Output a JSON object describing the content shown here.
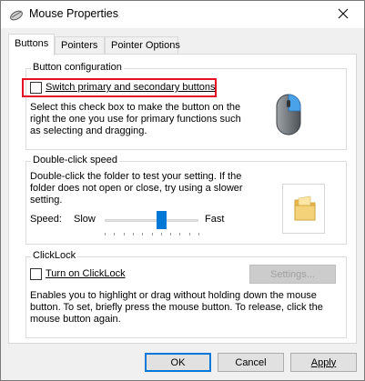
{
  "window": {
    "title": "Mouse Properties",
    "icon": "mouse-icon"
  },
  "tabs": [
    {
      "label": "Buttons",
      "active": true
    },
    {
      "label": "Pointers",
      "active": false
    },
    {
      "label": "Pointer Options",
      "active": false
    }
  ],
  "button_config": {
    "title": "Button configuration",
    "checkbox_label": "Switch primary and secondary buttons",
    "checked": false,
    "description": [
      "Select this check box to make the button on the",
      "right the one you use for primary functions such",
      "as selecting and dragging."
    ]
  },
  "double_click": {
    "title": "Double-click speed",
    "description": [
      "Double-click the folder to test your setting. If the",
      "folder does not open or close, try using a slower",
      "setting."
    ],
    "speed_label": "Speed:",
    "slow_label": "Slow",
    "fast_label": "Fast",
    "speed_value_fraction": 0.6
  },
  "clicklock": {
    "title": "ClickLock",
    "checkbox_label": "Turn on ClickLock",
    "checked": false,
    "settings_label": "Settings...",
    "description": [
      "Enables you to highlight or drag without holding down the mouse",
      "button. To set, briefly press the mouse button. To release, click the",
      "mouse button again."
    ]
  },
  "footer": {
    "ok_label": "OK",
    "cancel_label": "Cancel",
    "apply_label": "Apply"
  },
  "colors": {
    "accent": "#0078d7",
    "highlight": "#e81123",
    "folder": "#f3d27a"
  }
}
